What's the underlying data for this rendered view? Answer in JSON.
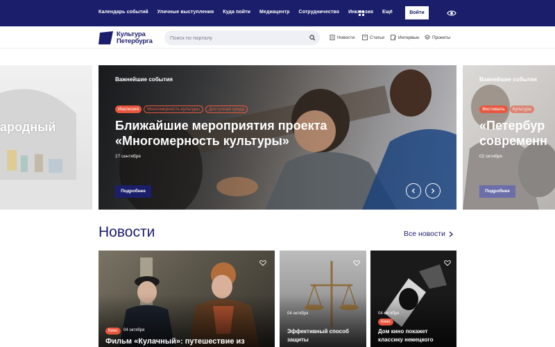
{
  "topbar": {
    "nav": [
      "Календарь событий",
      "Уличные выступления",
      "Куда пойти",
      "Медиацентр",
      "Сотрудничество",
      "Инклюзия",
      "Ещё"
    ],
    "login_label": "Войти"
  },
  "brand": {
    "line1": "Культура",
    "line2": "Петербурга"
  },
  "search": {
    "placeholder": "Поиск по порталу"
  },
  "header_nav": [
    {
      "label": "Новости",
      "icon": "document-icon"
    },
    {
      "label": "Статьи",
      "icon": "article-icon"
    },
    {
      "label": "Интервью",
      "icon": "interview-icon"
    },
    {
      "label": "Проекты",
      "icon": "projects-icon"
    }
  ],
  "carousel": {
    "prev_slide": {
      "title_fragment": "ародный"
    },
    "main_slide": {
      "eyebrow": "Важнейшие события",
      "chips": [
        "Инклюзия",
        "Многомерность культуры",
        "Доступная среда"
      ],
      "title_line1": "Ближайшие мероприятия проекта",
      "title_line2": "«Многомерность культуры»",
      "date": "27 сентября",
      "button": "Подробнее"
    },
    "next_slide": {
      "eyebrow": "Важнейшие события",
      "chip1": "Фестиваль",
      "chip2": "Культура",
      "title_line1": "«Петербур",
      "title_line2": "современн",
      "date": "02 октября",
      "button": "Подробнее"
    }
  },
  "news": {
    "title": "Новости",
    "all_link": "Все новости",
    "cards": [
      {
        "chip": "Кино",
        "date": "04 октября",
        "title": "Фильм «Кулачный»: путешествие из"
      },
      {
        "date": "04 октября",
        "title_line1": "Эффективный способ",
        "title_line2": "защиты"
      },
      {
        "date": "04 октября",
        "chip": "Кино",
        "title_line1": "Дом кино покажет",
        "title_line2": "классику немецкого"
      }
    ]
  },
  "colors": {
    "navy": "#1b1e6b",
    "accent": "#e8573d"
  }
}
